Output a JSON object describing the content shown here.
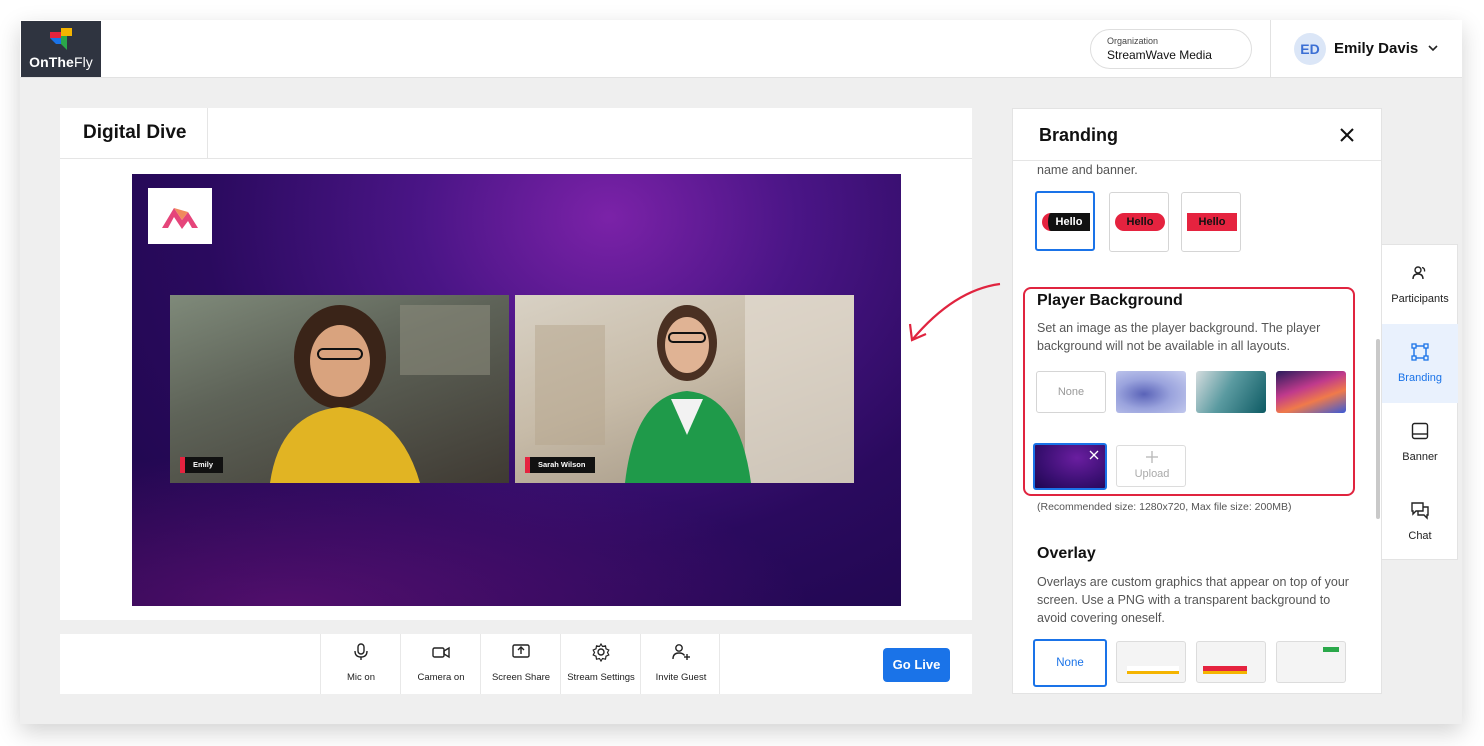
{
  "app": {
    "logo_text_bold": "OnThe",
    "logo_text_light": "Fly"
  },
  "header": {
    "org_label": "Organization",
    "org_name": "StreamWave Media",
    "user_initials": "ED",
    "user_name": "Emily Davis"
  },
  "stage": {
    "title": "Digital Dive",
    "participants": [
      {
        "name": "Emily"
      },
      {
        "name": "Sarah Wilson"
      }
    ]
  },
  "controls": {
    "items": [
      {
        "label": "Mic on",
        "icon": "mic-icon"
      },
      {
        "label": "Camera on",
        "icon": "camera-icon"
      },
      {
        "label": "Screen Share",
        "icon": "screen-share-icon"
      },
      {
        "label": "Stream Settings",
        "icon": "gear-icon"
      },
      {
        "label": "Invite Guest",
        "icon": "add-user-icon"
      }
    ],
    "go_live": "Go Live"
  },
  "branding": {
    "title": "Branding",
    "name_banner_fragment": "name and banner.",
    "banner_styles": [
      {
        "text": "Hello",
        "selected": true
      },
      {
        "text": "Hello",
        "selected": false
      },
      {
        "text": "Hello",
        "selected": false
      }
    ],
    "player_background": {
      "title": "Player Background",
      "description": "Set an image as the player background. The player background will not be available in all layouts.",
      "none_label": "None",
      "upload_label": "Upload",
      "note": "(Recommended size: 1280x720, Max file size: 200MB)"
    },
    "overlay": {
      "title": "Overlay",
      "description": "Overlays are custom graphics that appear on top of your screen. Use a PNG with a transparent background to avoid covering oneself.",
      "none_label": "None"
    }
  },
  "sidenav": {
    "items": [
      {
        "label": "Participants",
        "active": false
      },
      {
        "label": "Branding",
        "active": true
      },
      {
        "label": "Banner",
        "active": false
      },
      {
        "label": "Chat",
        "active": false
      }
    ]
  },
  "colors": {
    "accent": "#1a73e8",
    "highlight": "#e0243f",
    "brand_red": "#e5233f",
    "player_bg": "#3a0f72"
  }
}
